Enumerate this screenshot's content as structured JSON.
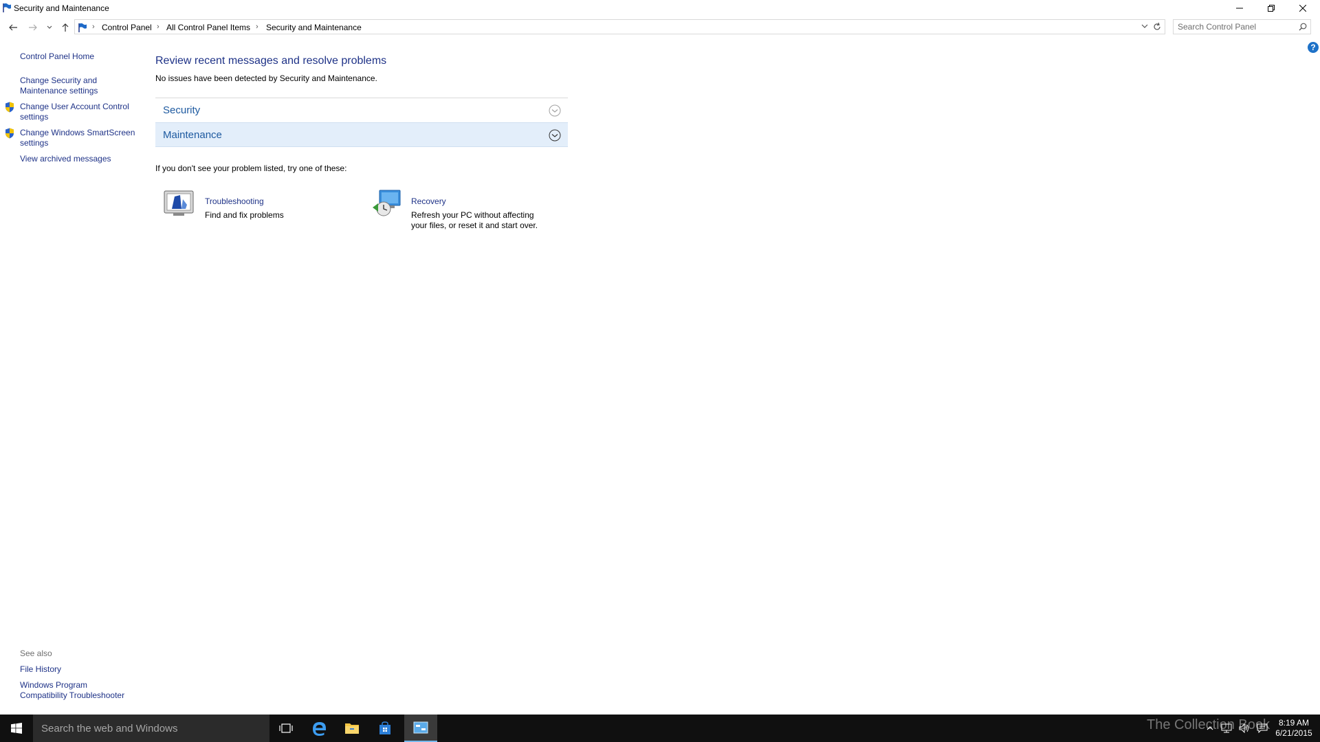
{
  "window": {
    "title": "Security and Maintenance",
    "minimize_icon": "minimize-icon",
    "restore_icon": "restore-icon",
    "close_icon": "close-icon"
  },
  "address_bar": {
    "breadcrumb": [
      "Control Panel",
      "All Control Panel Items",
      "Security and Maintenance"
    ],
    "search_placeholder": "Search Control Panel"
  },
  "left_pane": {
    "home": "Control Panel Home",
    "links": [
      {
        "label": "Change Security and Maintenance settings",
        "shield": false
      },
      {
        "label": "Change User Account Control settings",
        "shield": true
      },
      {
        "label": "Change Windows SmartScreen settings",
        "shield": true
      },
      {
        "label": "View archived messages",
        "shield": false
      }
    ],
    "see_also_title": "See also",
    "see_also": [
      "File History",
      "Windows Program Compatibility Troubleshooter"
    ]
  },
  "main": {
    "title": "Review recent messages and resolve problems",
    "subtitle": "No issues have been detected by Security and Maintenance.",
    "sections": [
      {
        "label": "Security",
        "expanded": false
      },
      {
        "label": "Maintenance",
        "expanded": false,
        "highlighted": true
      }
    ],
    "try_text": "If you don't see your problem listed, try one of these:",
    "tools": [
      {
        "name": "Troubleshooting",
        "desc": "Find and fix problems"
      },
      {
        "name": "Recovery",
        "desc": "Refresh your PC without affecting your files, or reset it and start over."
      }
    ]
  },
  "taskbar": {
    "search_text": "Search the web and Windows",
    "clock_time": "8:19 AM",
    "clock_date": "6/21/2015",
    "watermark": "The Collection Book",
    "accent": "#76b9ed"
  }
}
